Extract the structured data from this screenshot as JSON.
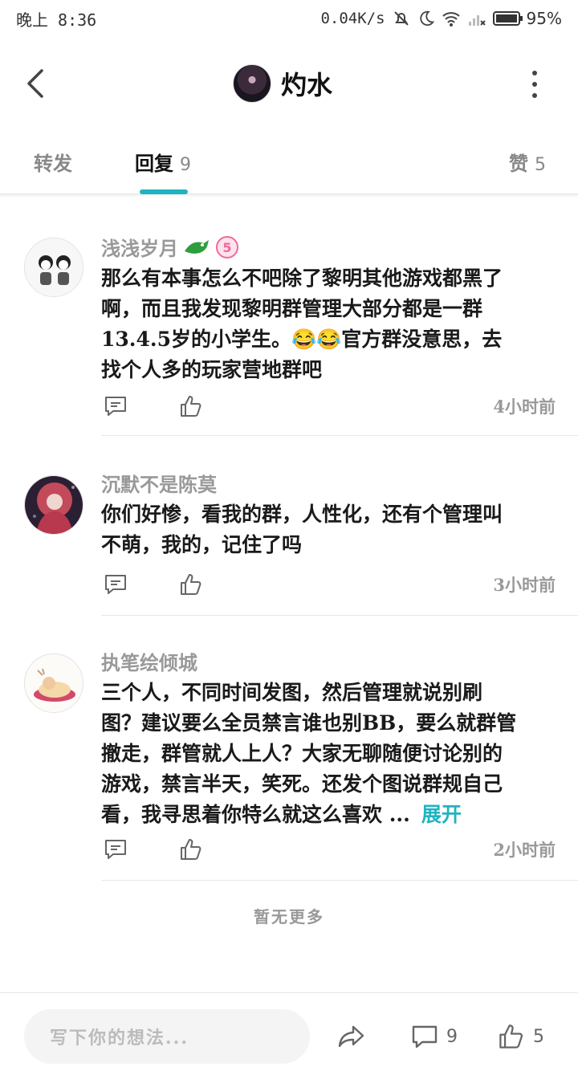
{
  "status_bar": {
    "time": "晚上 8:36",
    "net_speed": "0.04K/s",
    "battery": "95%"
  },
  "header": {
    "title": "灼水"
  },
  "tabs": {
    "repost_label": "转发",
    "reply_label": "回复",
    "reply_count": "9",
    "like_label": "赞",
    "like_count": "5",
    "active": "回复"
  },
  "comments": [
    {
      "username": "浅浅岁月",
      "badges": [
        "dragon-badge-icon",
        "level-5-badge-icon"
      ],
      "lines": [
        "那么有本事怎么不吧除了黎明其他游戏都黑了",
        "啊，而且我发现黎明群管理大部分都是一群",
        "13.4.5岁的小学生。😂😂官方群没意思，去",
        "找个人多的玩家营地群吧"
      ],
      "time": "4小时前"
    },
    {
      "username": "沉默不是陈莫",
      "lines": [
        "你们好惨，看我的群，人性化，还有个管理叫",
        "不萌，我的，记住了吗"
      ],
      "time": "3小时前"
    },
    {
      "username": "执笔绘倾城",
      "lines": [
        "三个人，不同时间发图，然后管理就说别刷",
        "图？建议要么全员禁言谁也别BB，要么就群管",
        "撤走，群管就人上人？大家无聊随便讨论别的",
        "游戏，禁言半天，笑死。还发个图说群规自己",
        "看，我寻思着你特么就这么喜欢  ..."
      ],
      "expand_label": "展开",
      "time": "2小时前"
    }
  ],
  "footer_note": "暂无更多",
  "bottom_bar": {
    "compose_placeholder": "写下你的想法...",
    "reply_count": "9",
    "like_count": "5"
  },
  "colors": {
    "accent": "#22b3c0",
    "muted_text": "#999999"
  }
}
